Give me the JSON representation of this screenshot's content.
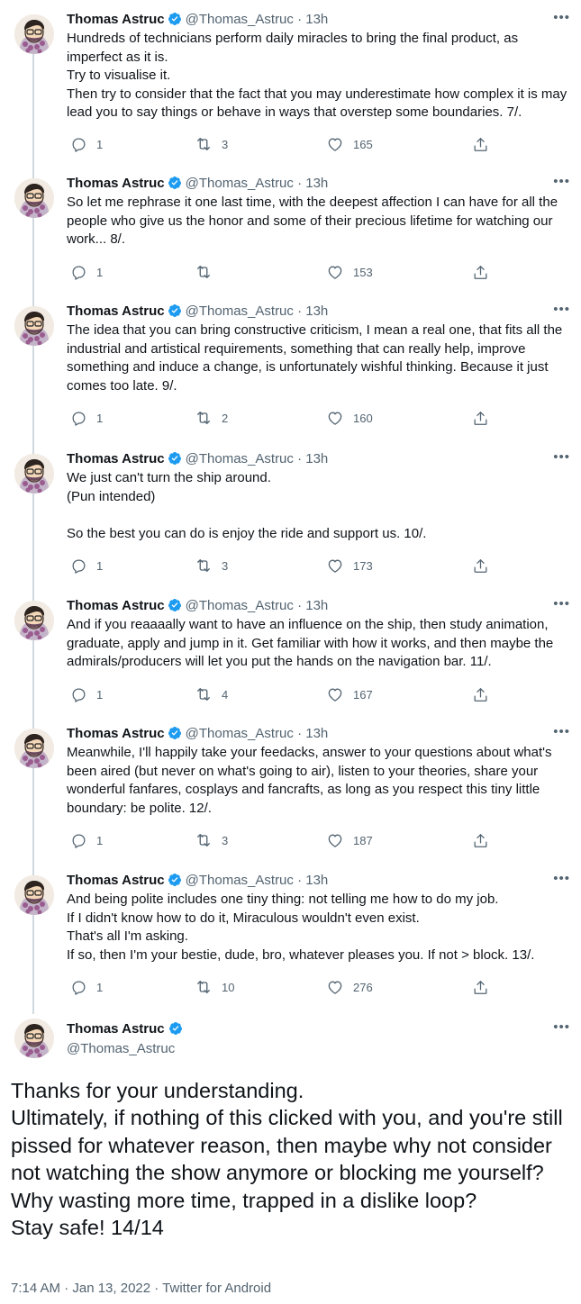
{
  "author": {
    "name": "Thomas Astruc",
    "handle": "@Thomas_Astruc",
    "time": "13h",
    "separator": "·"
  },
  "colors": {
    "verified": "#1d9bf0",
    "text": "#0f1419",
    "muted": "#536471",
    "line": "#cfd9de"
  },
  "icons": {
    "reply": "reply-icon",
    "retweet": "retweet-icon",
    "like": "heart-icon",
    "share": "share-icon",
    "verified": "verified-badge-icon",
    "more": "more-icon"
  },
  "tweets": [
    {
      "text": "Hundreds of technicians perform daily miracles to bring the final product, as imperfect as it is.\nTry to visualise it.\nThen try to consider that the fact that you may underestimate how complex it is may lead you to say things or behave in ways that overstep some boundaries. 7/.",
      "replies": "1",
      "retweets": "3",
      "likes": "165"
    },
    {
      "text": "So let me rephrase it one last time, with the deepest affection I can have for all the people who give us the honor and some of their precious lifetime for watching our work... 8/.",
      "replies": "1",
      "retweets": "",
      "likes": "153"
    },
    {
      "text": "The idea that you can bring constructive criticism, I mean a real one, that fits all the industrial and artistical requirements, something that can really help, improve something and induce a change, is unfortunately wishful thinking. Because it just comes too late. 9/.",
      "replies": "1",
      "retweets": "2",
      "likes": "160"
    },
    {
      "text": "We just can't turn the ship around.\n(Pun intended)\n\nSo the best you can do is enjoy the ride and support us. 10/.",
      "replies": "1",
      "retweets": "3",
      "likes": "173"
    },
    {
      "text": "And if you reaaaally want to have an influence on the ship, then study animation, graduate, apply and jump in it. Get familiar with how it works, and then maybe the admirals/producers will let you put the hands on the navigation bar. 11/.",
      "replies": "1",
      "retweets": "4",
      "likes": "167"
    },
    {
      "text": "Meanwhile, I'll happily take your feedacks, answer to your questions about what's been aired (but never on what's going to air), listen to your theories, share your wonderful fanfares, cosplays and fancrafts, as long as you respect this tiny little boundary: be polite. 12/.",
      "replies": "1",
      "retweets": "3",
      "likes": "187"
    },
    {
      "text": "And being polite includes one tiny thing: not telling me how to do my job.\nIf I didn't know how to do it, Miraculous wouldn't even exist.\nThat's all I'm asking.\nIf so, then I'm your bestie, dude, bro, whatever pleases you. If not > block. 13/.",
      "replies": "1",
      "retweets": "10",
      "likes": "276"
    }
  ],
  "final_tweet": {
    "text": "Thanks for your understanding.\nUltimately, if nothing of this clicked with you, and you're still pissed for whatever  reason, then maybe why not consider not watching the show anymore or blocking me yourself? Why wasting more time, trapped in a dislike loop?\nStay safe! 14/14",
    "meta": "7:14 AM · Jan 13, 2022 · Twitter for Android"
  }
}
